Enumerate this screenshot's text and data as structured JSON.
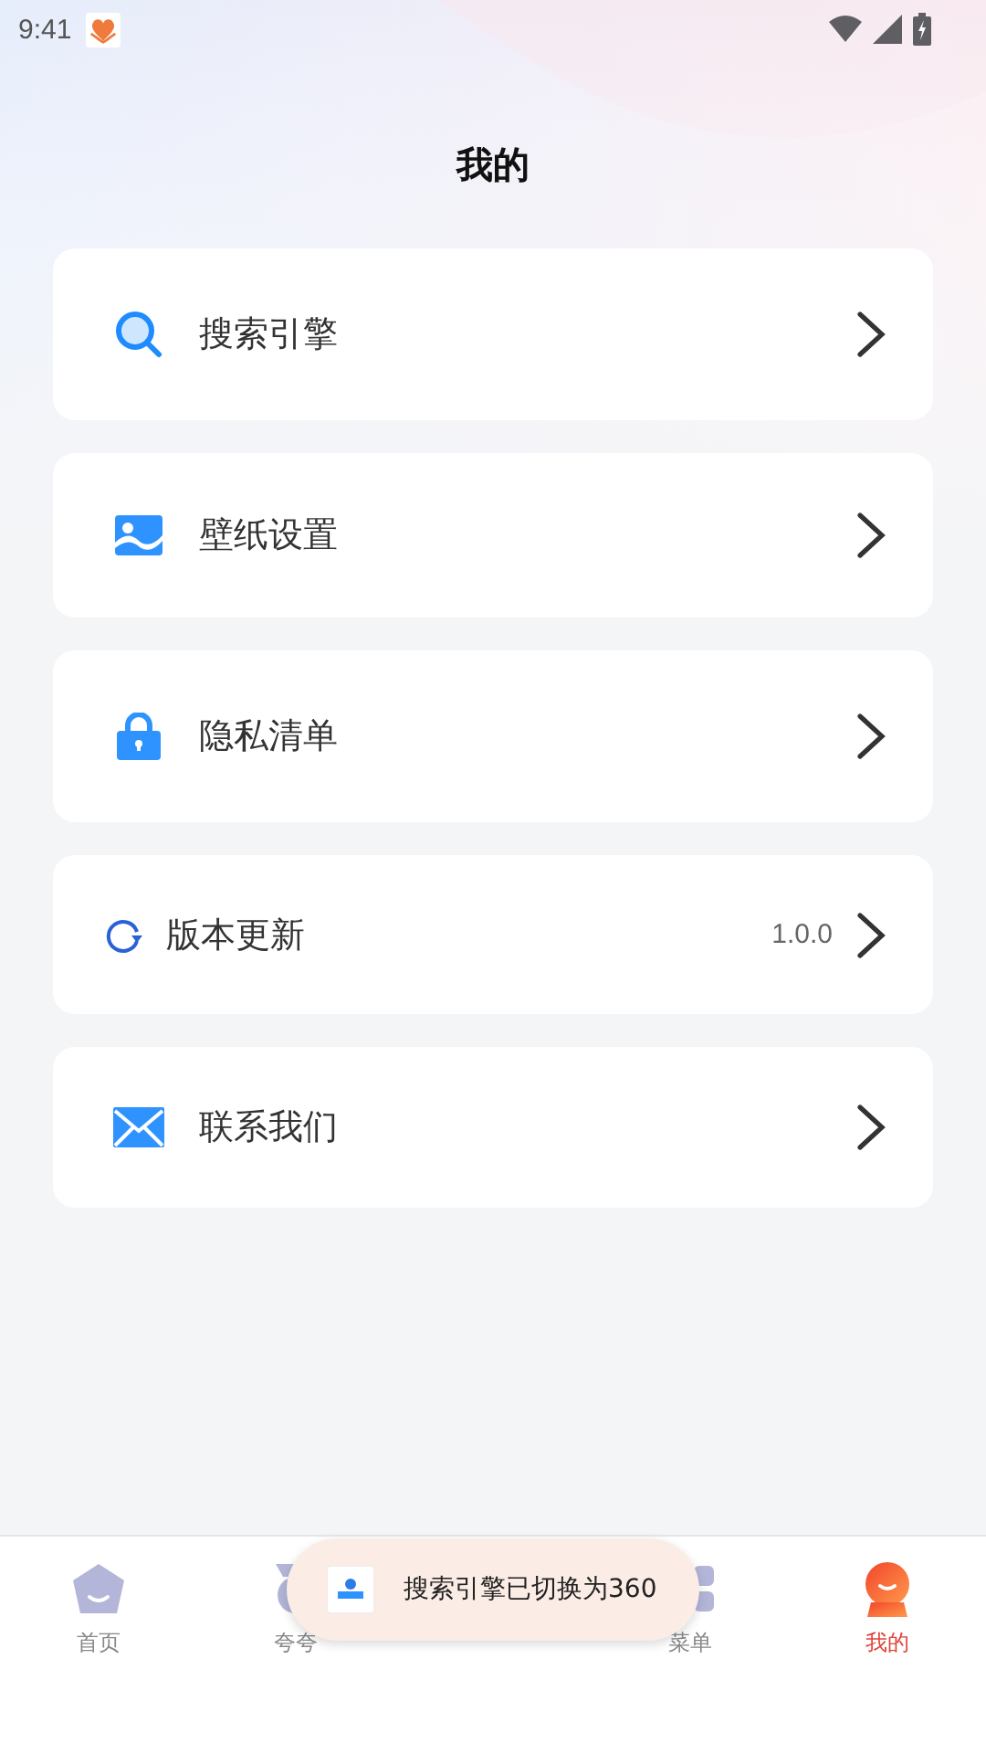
{
  "status_bar": {
    "time": "9:41"
  },
  "title": "我的",
  "menu": [
    {
      "kind": "search",
      "label": "搜索引擎"
    },
    {
      "kind": "image",
      "label": "壁纸设置"
    },
    {
      "kind": "lock",
      "label": "隐私清单"
    },
    {
      "kind": "refresh",
      "label": "版本更新",
      "value": "1.0.0"
    },
    {
      "kind": "mail",
      "label": "联系我们"
    }
  ],
  "tabs": [
    {
      "kind": "home",
      "label": "首页",
      "selected": false
    },
    {
      "kind": "praise",
      "label": "夸夸",
      "selected": false
    },
    {
      "kind": "covered"
    },
    {
      "kind": "menu",
      "label": "菜单",
      "selected": false
    },
    {
      "kind": "me",
      "label": "我的",
      "selected": true
    }
  ],
  "toast": {
    "text": "搜索引擎已切换为360"
  }
}
